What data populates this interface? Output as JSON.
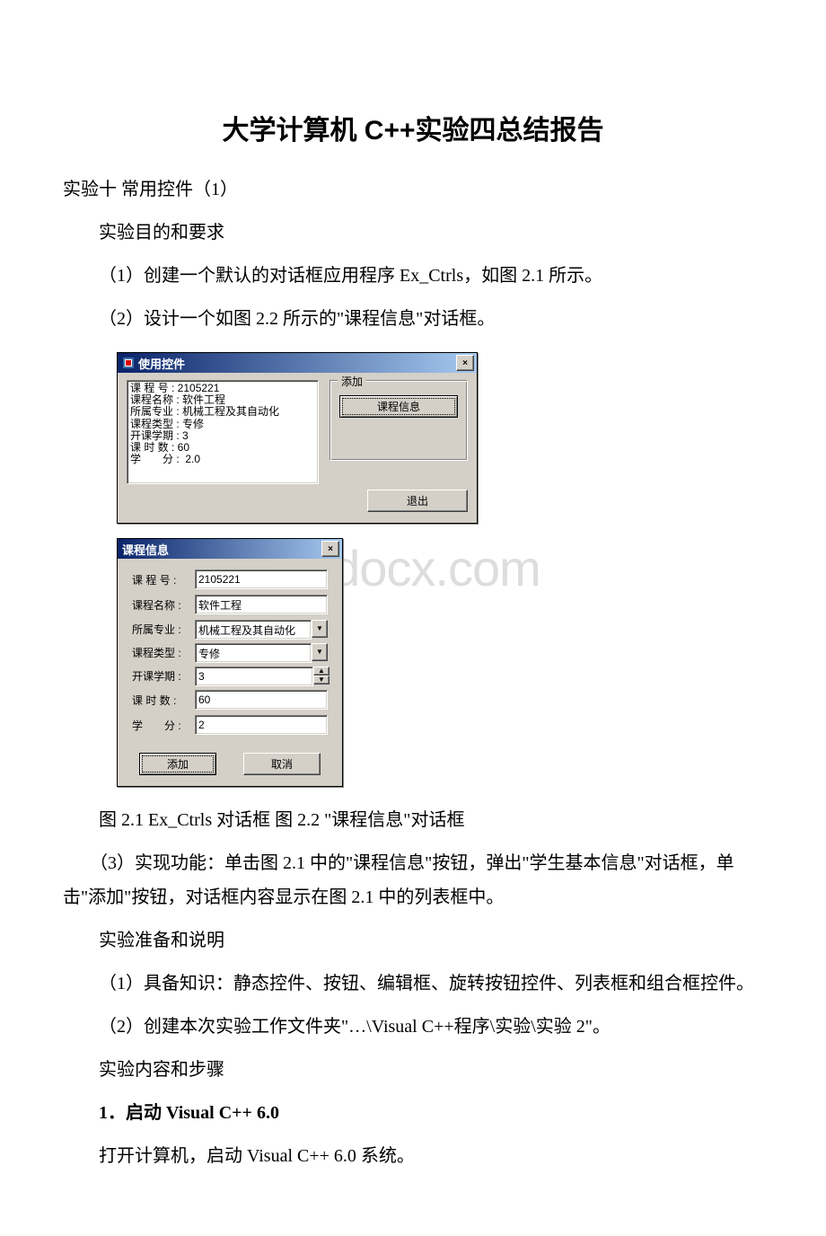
{
  "doc": {
    "title": "大学计算机 C++实验四总结报告",
    "p1": " 实验十 常用控件（1）",
    "p2": "实验目的和要求",
    "p3": "（1）创建一个默认的对话框应用程序 Ex_Ctrls，如图 2.1 所示。",
    "p4": "（2）设计一个如图 2.2 所示的\"课程信息\"对话框。",
    "caption": " 图 2.1 Ex_Ctrls 对话框 图 2.2 \"课程信息\"对话框",
    "p5": "　　（3）实现功能：单击图 2.1 中的\"课程信息\"按钮，弹出\"学生基本信息\"对话框，单击\"添加\"按钮，对话框内容显示在图 2.1 中的列表框中。",
    "p6": "实验准备和说明",
    "p7": "（1）具备知识：静态控件、按钮、编辑框、旋转按钮控件、列表框和组合框控件。",
    "p8": "（2）创建本次实验工作文件夹\"…\\Visual C++程序\\实验\\实验 2\"。",
    "p9": "实验内容和步骤",
    "p10": "1．启动 Visual C++ 6.0",
    "p11": "打开计算机，启动 Visual C++ 6.0 系统。"
  },
  "fig1": {
    "title": "使用控件",
    "close": "×",
    "list": "课 程 号 : 2105221\n课程名称 : 软件工程\n所属专业 : 机械工程及其自动化\n课程类型 : 专修\n开课学期 : 3\n课 时 数 : 60\n学　　分 :  2.0",
    "groupTitle": "添加",
    "btnCourseInfo": "课程信息",
    "btnExit": "退出"
  },
  "fig2": {
    "title": "课程信息",
    "close": "×",
    "labels": {
      "code": "课 程 号 :",
      "name": "课程名称 :",
      "major": "所属专业 :",
      "type": "课程类型 :",
      "term": "开课学期 :",
      "hours": "课 时 数 :",
      "credit": "学　　分 :"
    },
    "values": {
      "code": "2105221",
      "name": "软件工程",
      "major": "机械工程及其自动化",
      "type": "专修",
      "term": "3",
      "hours": "60",
      "credit": "2"
    },
    "btnAdd": "添加",
    "btnCancel": "取消"
  },
  "watermark": "bdocx.com"
}
